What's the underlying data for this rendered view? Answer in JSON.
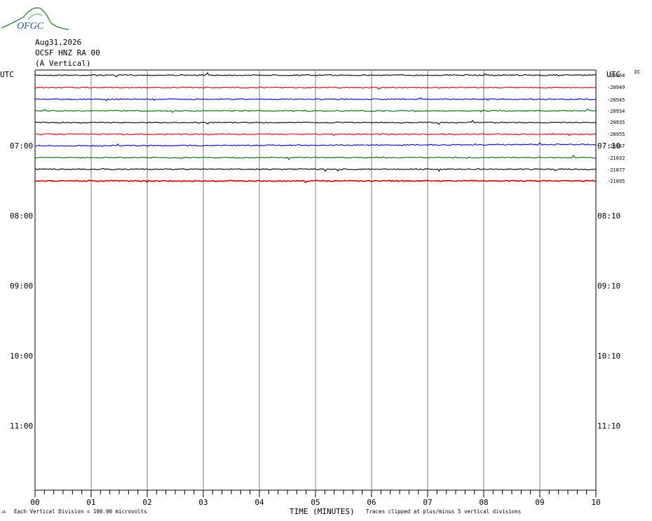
{
  "logo": {
    "text": "OFGC"
  },
  "header": {
    "date": "Aug31,2026",
    "station": "OCSF HNZ RA 00",
    "component": "(A Vertical)"
  },
  "labels": {
    "utc_left": "UTC",
    "utc_right": "UTC",
    "dc_header": "DC"
  },
  "left_time_labels": [
    "07:00",
    "08:00",
    "09:00",
    "10:00",
    "11:00"
  ],
  "right_time_labels": [
    "07:10",
    "08:10",
    "09:10",
    "10:10",
    "11:10"
  ],
  "dc_offsets": [
    "-20964",
    "-20949",
    "-20945",
    "-20934",
    "-20935",
    "-20955",
    "-20987",
    "-21032",
    "-21077",
    "-21095"
  ],
  "footer": {
    "left_mark": "JA",
    "division": "Each Vertical Division =  100.00 microvolts",
    "xlabel": "TIME (MINUTES)",
    "clip": "Traces clipped at plus/minus 5 vertical divisions"
  },
  "chart_data": {
    "type": "line",
    "title": "OCSF HNZ RA 00",
    "xlabel": "TIME (MINUTES)",
    "xlim": [
      0,
      10
    ],
    "x_ticks": [
      "00",
      "01",
      "02",
      "03",
      "04",
      "05",
      "06",
      "07",
      "08",
      "09",
      "10"
    ],
    "grid": true,
    "trace_colors": [
      "#000000",
      "#cc0000",
      "#0000cc",
      "#006600"
    ],
    "traces": [
      {
        "dc": -20964,
        "color": "#000000"
      },
      {
        "dc": -20949,
        "color": "#cc0000"
      },
      {
        "dc": -20945,
        "color": "#0000cc"
      },
      {
        "dc": -20934,
        "color": "#006600"
      },
      {
        "dc": -20935,
        "color": "#000000"
      },
      {
        "dc": -20955,
        "color": "#cc0000"
      },
      {
        "dc": -20987,
        "color": "#0000cc"
      },
      {
        "dc": -21032,
        "color": "#006600"
      },
      {
        "dc": -21077,
        "color": "#000000"
      },
      {
        "dc": -21095,
        "color": "#cc0000"
      }
    ]
  }
}
